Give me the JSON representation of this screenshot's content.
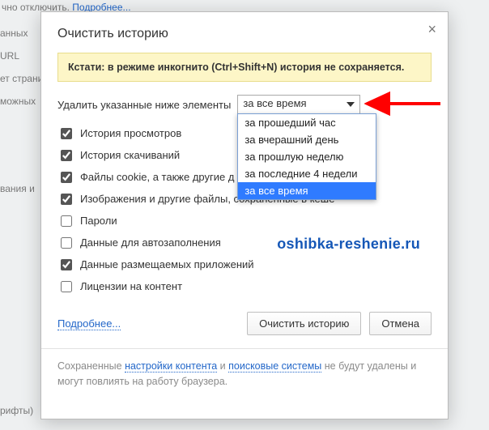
{
  "background": {
    "line1_prefix": "чно отключить. ",
    "line1_link": "Подробнее...",
    "line2": "анных",
    "line3": "URL",
    "line4": "ет страни",
    "line5": "можных",
    "line6": "вания и",
    "line7": "рифты)"
  },
  "modal": {
    "title": "Очистить историю",
    "close": "×",
    "notice": "Кстати: в режиме инкогнито (Ctrl+Shift+N) история не сохраняется.",
    "select_label": "Удалить указанные ниже элементы",
    "select_value": "за все время",
    "options": [
      "за прошедший час",
      "за вчерашний день",
      "за прошлую неделю",
      "за последние 4 недели",
      "за все время"
    ],
    "checks": [
      {
        "label": "История просмотров",
        "checked": true
      },
      {
        "label": "История скачиваний",
        "checked": true
      },
      {
        "label": "Файлы cookie, а также другие д",
        "checked": true
      },
      {
        "label": "Изображения и другие файлы, сохраненные в кеше",
        "checked": true
      },
      {
        "label": "Пароли",
        "checked": false
      },
      {
        "label": "Данные для автозаполнения",
        "checked": false
      },
      {
        "label": "Данные размещаемых приложений",
        "checked": true
      },
      {
        "label": "Лицензии на контент",
        "checked": false
      }
    ],
    "more_link": "Подробнее...",
    "btn_clear": "Очистить историю",
    "btn_cancel": "Отмена",
    "footer_pre": "Сохраненные ",
    "footer_lk1": "настройки контента",
    "footer_mid": " и ",
    "footer_lk2": "поисковые системы",
    "footer_post": " не будут удалены и могут повлиять на работу браузера."
  },
  "watermark": "oshibka-reshenie.ru",
  "colors": {
    "arrow": "#ff0000",
    "highlight": "#2f7bff"
  }
}
